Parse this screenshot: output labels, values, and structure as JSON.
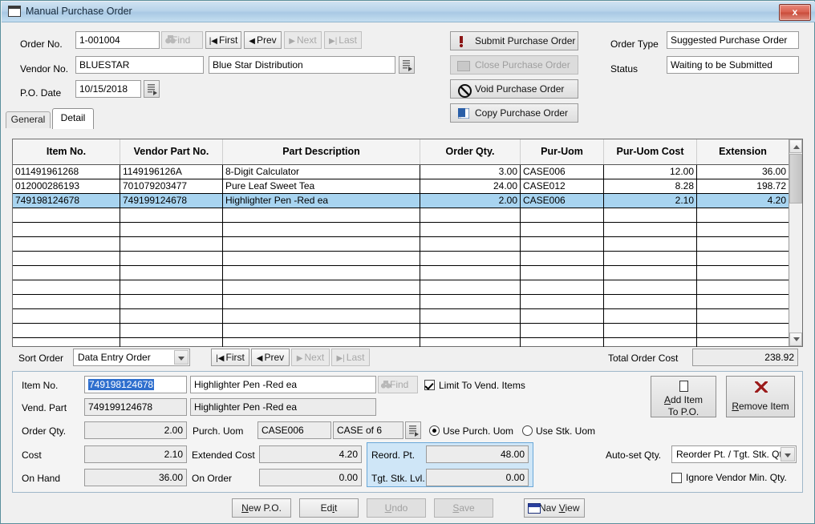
{
  "window": {
    "title": "Manual Purchase Order",
    "close_label": "x",
    "title_icon": "window-icon"
  },
  "header": {
    "order_no_label": "Order No.",
    "order_no_value": "1-001004",
    "vendor_no_label": "Vendor No.",
    "vendor_no_value": "BLUESTAR",
    "vendor_name_value": "Blue Star Distribution",
    "po_date_label": "P.O. Date",
    "po_date_value": "10/15/2018",
    "find_label": "Find",
    "nav": [
      {
        "label": "First",
        "glyph": "|◀",
        "enabled": true
      },
      {
        "label": "Prev",
        "glyph": "◀",
        "enabled": true
      },
      {
        "label": "Next",
        "glyph": "▶",
        "enabled": false
      },
      {
        "label": "Last",
        "glyph": "▶|",
        "enabled": false
      }
    ]
  },
  "actions": {
    "submit_label": "Submit Purchase Order",
    "close_po_label": "Close Purchase Order",
    "void_label": "Void Purchase Order",
    "copy_label": "Copy Purchase Order",
    "submit_enabled": true,
    "close_po_enabled": false,
    "void_enabled": true,
    "copy_enabled": true
  },
  "status": {
    "order_type_label": "Order Type",
    "order_type_value": "Suggested Purchase Order",
    "status_label": "Status",
    "status_value": "Waiting to be Submitted"
  },
  "tabs": [
    {
      "label": "General",
      "active": false
    },
    {
      "label": "Detail",
      "active": true
    }
  ],
  "grid": {
    "columns": [
      "Item No.",
      "Vendor Part No.",
      "Part Description",
      "Order Qty.",
      "Pur-Uom",
      "Pur-Uom Cost",
      "Extension"
    ],
    "rows": [
      {
        "item_no": "011491961268",
        "vendor_part_no": "1149196126A",
        "part_description": "8-Digit Calculator",
        "order_qty": "3.00",
        "pur_uom": "CASE006",
        "pur_uom_cost": "12.00",
        "extension": "36.00",
        "selected": false
      },
      {
        "item_no": "012000286193",
        "vendor_part_no": "701079203477",
        "part_description": "Pure Leaf Sweet Tea",
        "order_qty": "24.00",
        "pur_uom": "CASE012",
        "pur_uom_cost": "8.28",
        "extension": "198.72",
        "selected": false
      },
      {
        "item_no": "749198124678",
        "vendor_part_no": "749199124678",
        "part_description": "Highlighter Pen -Red ea",
        "order_qty": "2.00",
        "pur_uom": "CASE006",
        "pur_uom_cost": "2.10",
        "extension": "4.20",
        "selected": true
      }
    ],
    "empty_row_count": 10
  },
  "sortbar": {
    "sort_order_label": "Sort Order",
    "sort_order_value": "Data Entry Order",
    "nav": [
      {
        "label": "First",
        "glyph": "|◀",
        "enabled": true
      },
      {
        "label": "Prev",
        "glyph": "◀",
        "enabled": true
      },
      {
        "label": "Next",
        "glyph": "▶",
        "enabled": false
      },
      {
        "label": "Last",
        "glyph": "▶|",
        "enabled": false
      }
    ],
    "total_label": "Total Order Cost",
    "total_value": "238.92"
  },
  "detail": {
    "item_no_label": "Item No.",
    "item_no_value": "749198124678",
    "item_desc_value": "Highlighter Pen -Red ea",
    "find_label": "Find",
    "limit_vend_label": "Limit To Vend. Items",
    "limit_vend_checked": true,
    "vend_part_label": "Vend. Part",
    "vend_part_value": "749199124678",
    "vend_part_desc_value": "Highlighter Pen -Red ea",
    "order_qty_label": "Order Qty.",
    "order_qty_value": "2.00",
    "purch_uom_label": "Purch. Uom",
    "purch_uom_code": "CASE006",
    "purch_uom_desc": "CASE of 6",
    "use_purch_uom_label": "Use Purch. Uom",
    "use_stk_uom_label": "Use Stk. Uom",
    "uom_mode": "purch",
    "cost_label": "Cost",
    "cost_value": "2.10",
    "extended_cost_label": "Extended Cost",
    "extended_cost_value": "4.20",
    "on_hand_label": "On Hand",
    "on_hand_value": "36.00",
    "on_order_label": "On Order",
    "on_order_value": "0.00",
    "reorder_pt_label": "Reord. Pt.",
    "reorder_pt_value": "48.00",
    "tgt_stk_lvl_label": "Tgt. Stk. Lvl.",
    "tgt_stk_lvl_value": "0.00",
    "add_item_line1": "Add Item",
    "add_item_line2": "To P.O.",
    "remove_item_label": "Remove Item",
    "auto_set_qty_label": "Auto-set Qty.",
    "auto_set_qty_value": "Reorder Pt. / Tgt. Stk. Qty.",
    "ignore_min_label": "Ignore Vendor Min. Qty.",
    "ignore_min_checked": false
  },
  "footer": {
    "new_po_label": "New P.O.",
    "edit_label": "Edit",
    "undo_label": "Undo",
    "save_label": "Save",
    "nav_view_label": "Nav View",
    "undo_enabled": false,
    "save_enabled": false
  },
  "colors": {
    "selection_blue": "#a8d4f0",
    "reorder_panel_blue": "#cfe6f7",
    "titlebar_blue": "#b9d4ea",
    "close_red": "#d9604f"
  }
}
